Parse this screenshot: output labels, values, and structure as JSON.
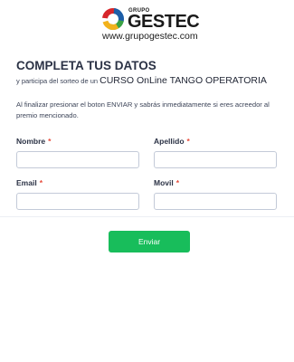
{
  "brand": {
    "small": "GRUPO",
    "name": "GESTEC",
    "website": "www.grupogestec.com",
    "colors": {
      "red": "#d7262b",
      "blue": "#1d5ea8",
      "green": "#3aa245",
      "yellow": "#f2b21b"
    }
  },
  "form": {
    "title": "COMPLETA TUS DATOS",
    "subtitle_prefix": "y participa del sorteo de un ",
    "subtitle_course": "CURSO OnLine TANGO OPERATORIA",
    "intro": "Al finalizar presionar el boton ENVIAR y sabrás inmediatamente si eres acreedor al premio mencionado.",
    "required_mark": "*",
    "fields": {
      "nombre": {
        "label": "Nombre",
        "value": ""
      },
      "apellido": {
        "label": "Apellido",
        "value": ""
      },
      "email": {
        "label": "Email",
        "value": ""
      },
      "movil": {
        "label": "Movil",
        "value": ""
      }
    },
    "submit_label": "Enviar"
  },
  "colors": {
    "accent": "#18bd5b",
    "required": "#e74c3c",
    "text": "#2b3245"
  }
}
